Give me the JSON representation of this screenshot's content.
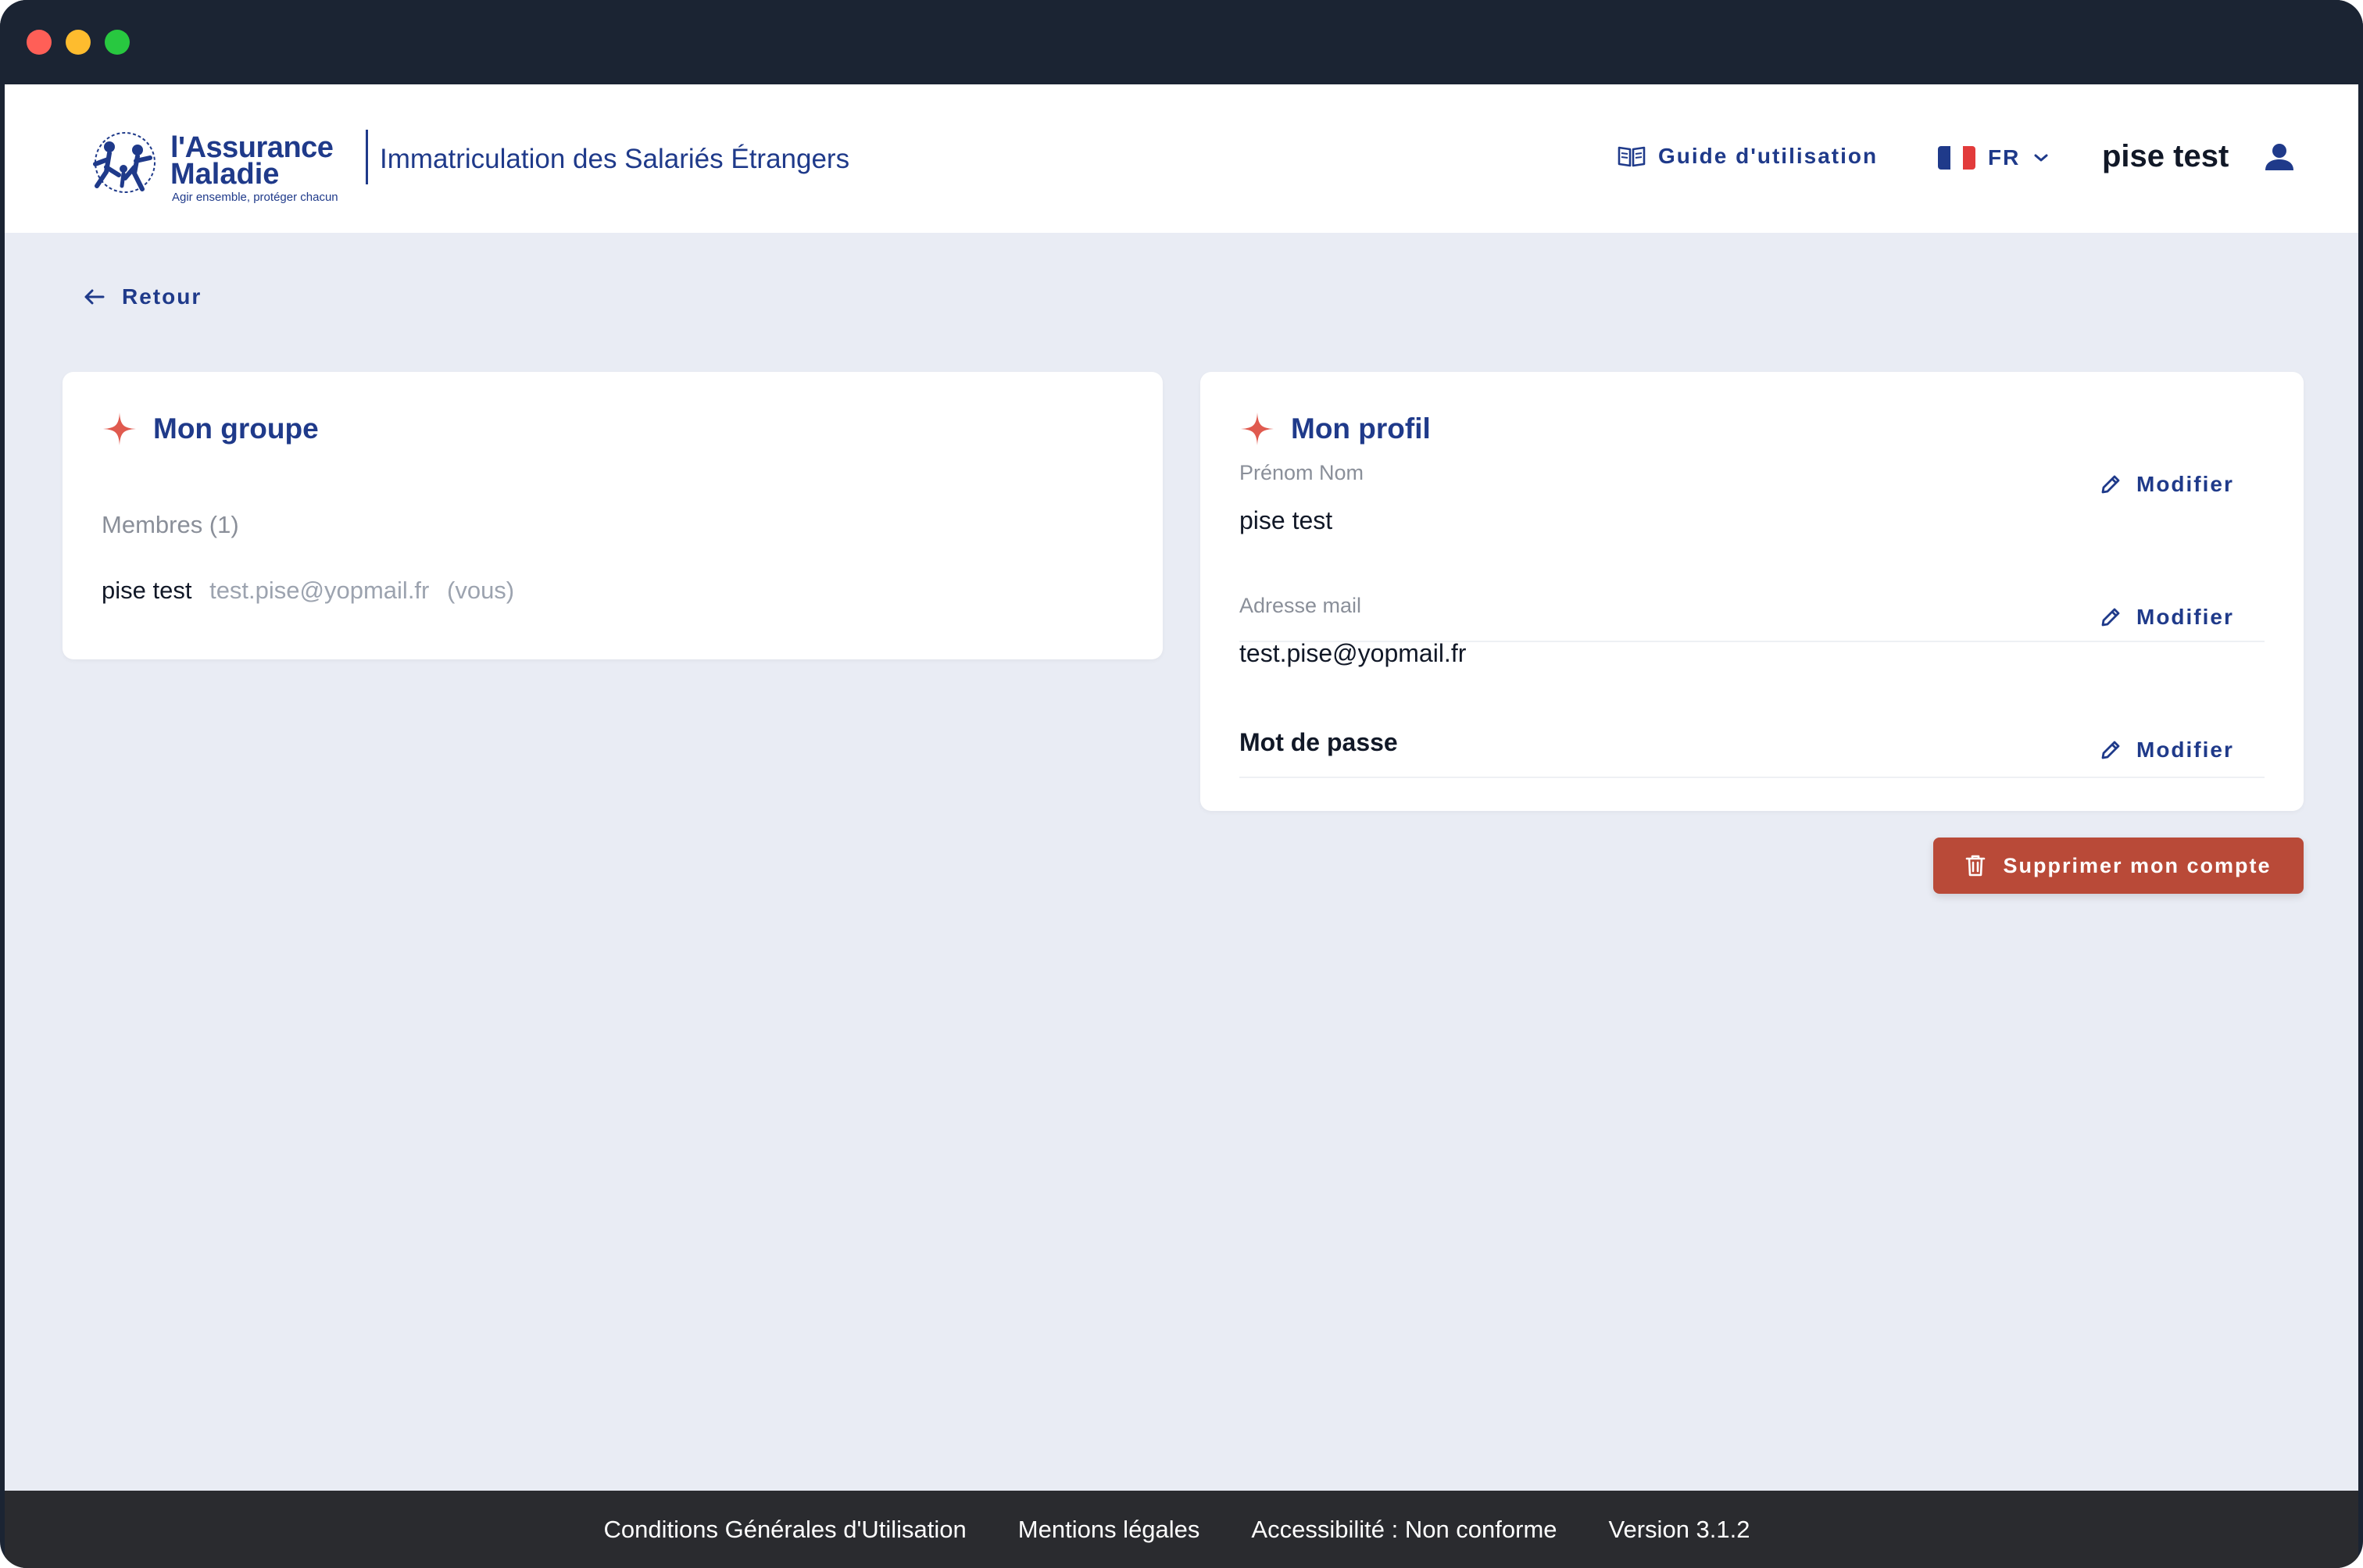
{
  "window": {
    "traffic_lights": [
      "close",
      "minimize",
      "zoom"
    ]
  },
  "header": {
    "logo": {
      "brand_line1": "l'Assurance",
      "brand_line2": "Maladie",
      "tagline": "Agir ensemble, protéger chacun",
      "icon": "assurance-maladie-logo-icon"
    },
    "app_title": "Immatriculation des Salariés Étrangers",
    "guide_label": "Guide d'utilisation",
    "guide_icon": "book-open-icon",
    "language": {
      "selected": "FR",
      "flag_colors": [
        "#1f3a8a",
        "#ffffff",
        "#e23b3b"
      ]
    },
    "username": "pise test",
    "user_icon": "person-icon"
  },
  "back_label": "Retour",
  "group_card": {
    "title": "Mon groupe",
    "members_label": "Membres (1)",
    "members": [
      {
        "name": "pise test",
        "email": "test.pise@yopmail.fr",
        "tag": "(vous)"
      }
    ]
  },
  "profile_card": {
    "title": "Mon profil",
    "name_label": "Prénom Nom",
    "name_value": "pise test",
    "email_label": "Adresse mail",
    "email_value": "test.pise@yopmail.fr",
    "password_label": "Mot de passe",
    "modify_label": "Modifier"
  },
  "delete_account_label": "Supprimer mon compte",
  "footer": {
    "cgu": "Conditions Générales d'Utilisation",
    "legal": "Mentions légales",
    "accessibility": "Accessibilité : Non conforme",
    "version": "Version 3.1.2"
  },
  "colors": {
    "primary": "#1f3a8a",
    "accent_star": "#e05a4f",
    "danger": "#b94a38",
    "background": "#e9ecf4"
  }
}
